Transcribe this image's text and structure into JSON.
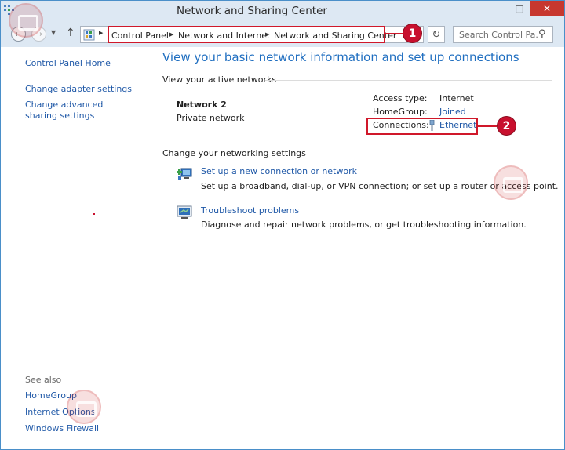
{
  "window": {
    "title": "Network and Sharing Center"
  },
  "navigation": {
    "breadcrumb": [
      "Control Panel",
      "Network and Internet",
      "Network and Sharing Center"
    ],
    "search_placeholder": "Search Control Pa..."
  },
  "sidebar": {
    "home": "Control Panel Home",
    "tasks": [
      "Change adapter settings",
      "Change advanced sharing settings"
    ],
    "see_also_heading": "See also",
    "see_also": [
      "HomeGroup",
      "Internet Options",
      "Windows Firewall"
    ]
  },
  "main": {
    "heading": "View your basic network information and set up connections",
    "active_networks_heading": "View your active networks",
    "network": {
      "name": "Network  2",
      "category": "Private network",
      "access_type_label": "Access type:",
      "access_type_value": "Internet",
      "homegroup_label": "HomeGroup:",
      "homegroup_value": "Joined",
      "connections_label": "Connections:",
      "connections_value": "Ethernet"
    },
    "change_settings_heading": "Change your networking settings",
    "tasks": [
      {
        "icon": "network-setup-icon",
        "link": "Set up a new connection or network",
        "description": "Set up a broadband, dial-up, or VPN connection; or set up a router or access point."
      },
      {
        "icon": "troubleshoot-icon",
        "link": "Troubleshoot problems",
        "description": "Diagnose and repair network problems, or get troubleshooting information."
      }
    ]
  },
  "annotations": [
    "1",
    "2"
  ],
  "colors": {
    "link": "#1f58a7",
    "heading": "#1f6ec0",
    "callout": "#d0182a",
    "close_button": "#c7372f",
    "chrome": "#dde8f3"
  }
}
